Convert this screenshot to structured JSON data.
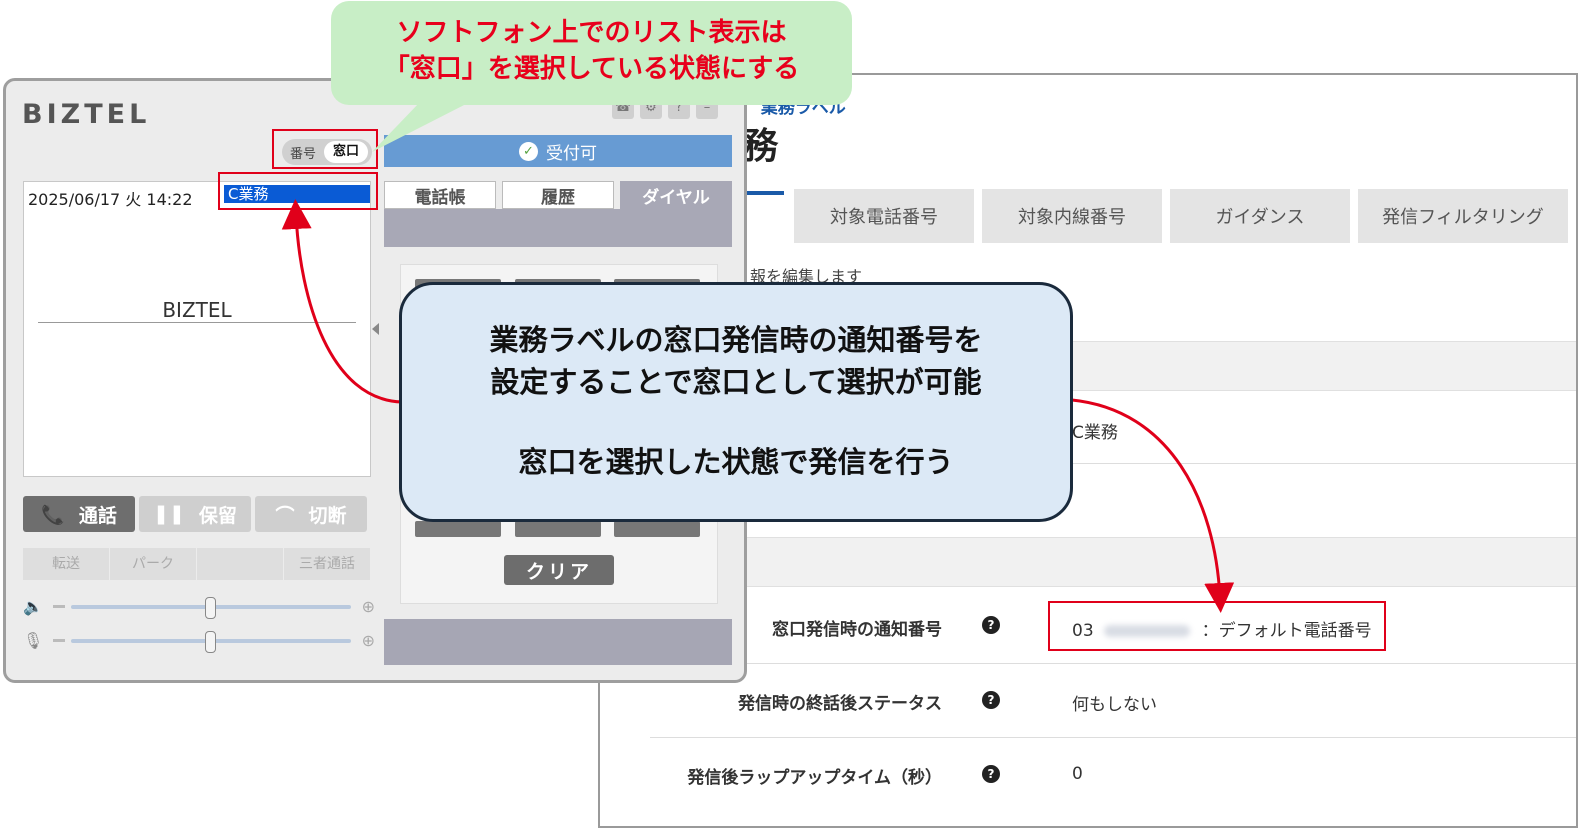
{
  "settings": {
    "breadcrumb_sep": "›",
    "breadcrumb": "業務ラベル",
    "title": "務",
    "tabs": [
      "対象電話番号",
      "対象内線番号",
      "ガイダンス",
      "発信フィルタリング"
    ],
    "description": "報を編集します",
    "name_value": "C業務",
    "fields": [
      {
        "label": "窓口発信時の通知番号",
        "value_prefix": "03",
        "value_suffix": "：デフォルト電話番号"
      },
      {
        "label": "発信時の終話後ステータス",
        "value": "何もしない"
      },
      {
        "label": "発信後ラップアップタイム（秒）",
        "value": "0"
      }
    ],
    "help_glyph": "?"
  },
  "softphone": {
    "logo": "BIZTEL",
    "toggle": {
      "number": "番号",
      "window": "窓口"
    },
    "datetime": "2025/06/17 火 14:22",
    "selected_window": "C業務",
    "display_brand": "BIZTEL",
    "buttons": {
      "call": "通話",
      "hold": "保留",
      "hangup": "切断"
    },
    "sub_buttons": [
      "転送",
      "パーク",
      "",
      "三者通話"
    ],
    "status": "受付可",
    "tabs": [
      "電話帳",
      "履歴",
      "ダイヤル"
    ],
    "clear": "クリア",
    "icons": [
      "speaker-icon",
      "microphone-icon",
      "phone-icon",
      "pause-icon",
      "hangup-icon",
      "check-icon",
      "settings-icon",
      "help-icon",
      "minimize-icon"
    ]
  },
  "annotations": {
    "green_line1": "ソフトフォン上でのリスト表示は",
    "green_line2": "「窓口」を選択している状態にする",
    "blue_line1": "業務ラベルの窓口発信時の通知番号を",
    "blue_line2": "設定することで窓口として選択が可能",
    "blue_line3": "窓口を選択した状態で発信を行う"
  },
  "colors": {
    "accent_blue": "#1a5aa8",
    "highlight_red": "#e0001a",
    "status_blue": "#679bd3",
    "selection_blue": "#0a5bd5"
  }
}
